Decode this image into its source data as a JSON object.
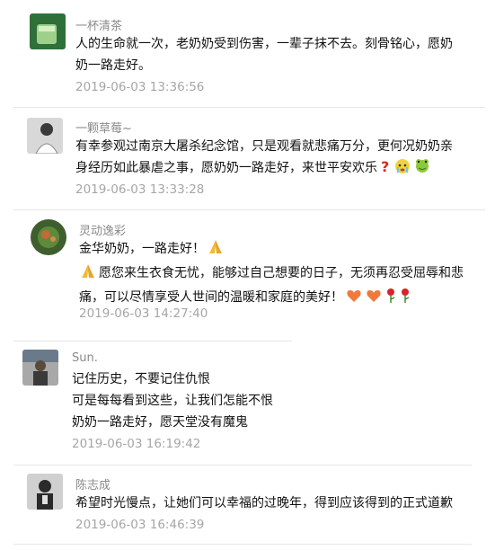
{
  "comments": [
    {
      "name": "一杯清茶",
      "lines": [
        "人的生命就一次，老奶奶受到伤害，一辈子抹不去。刻骨铭心，愿奶",
        "奶一路走好。"
      ],
      "time": "2019-06-03 13:36:56",
      "avatar_colors": [
        "#2f6f3a",
        "#9fd08a"
      ]
    },
    {
      "name": "一颗草莓~",
      "lines": [
        "有幸参观过南京大屠杀纪念馆，只是观看就悲痛万分，更何况奶奶亲",
        "身经历如此暴虐之事，愿奶奶一路走好，来世平安欢乐"
      ],
      "line_icons": [
        "question-mark-emoji",
        "crying-face-emoji",
        "frog-emoji"
      ],
      "time": "2019-06-03 13:33:28",
      "avatar_colors": [
        "#3a3a3a",
        "#d8d8d8"
      ]
    },
    {
      "name": "灵动逸彩",
      "lines": [
        "金华奶奶，一路走好！",
        "愿您来生衣食无忧，能够过自己想要的日子，无须再忍受屈辱和悲",
        "痛，可以尽情享受人世间的温暖和家庭的美好！"
      ],
      "line_icons": [
        "praying-hands-emoji",
        "heart-emoji",
        "rose-emoji"
      ],
      "time": "2019-06-03 14:27:40",
      "avatar_colors": [
        "#3f5e2e",
        "#c46a3a"
      ]
    },
    {
      "name": "Sun.",
      "lines": [
        "记住历史，不要记住仇恨",
        "可是每每看到这些，让我们怎能不恨",
        "奶奶一路走好，愿天堂没有魔鬼"
      ],
      "time": "2019-06-03 16:19:42",
      "avatar_colors": [
        "#5a4a3a",
        "#a8a8a8"
      ]
    },
    {
      "name": "陈志成",
      "lines": [
        "希望时光慢点，让她们可以幸福的过晚年，得到应该得到的正式道歉"
      ],
      "time": "2019-06-03 16:46:39",
      "avatar_colors": [
        "#2a2a2a",
        "#d0d0d0"
      ]
    }
  ]
}
